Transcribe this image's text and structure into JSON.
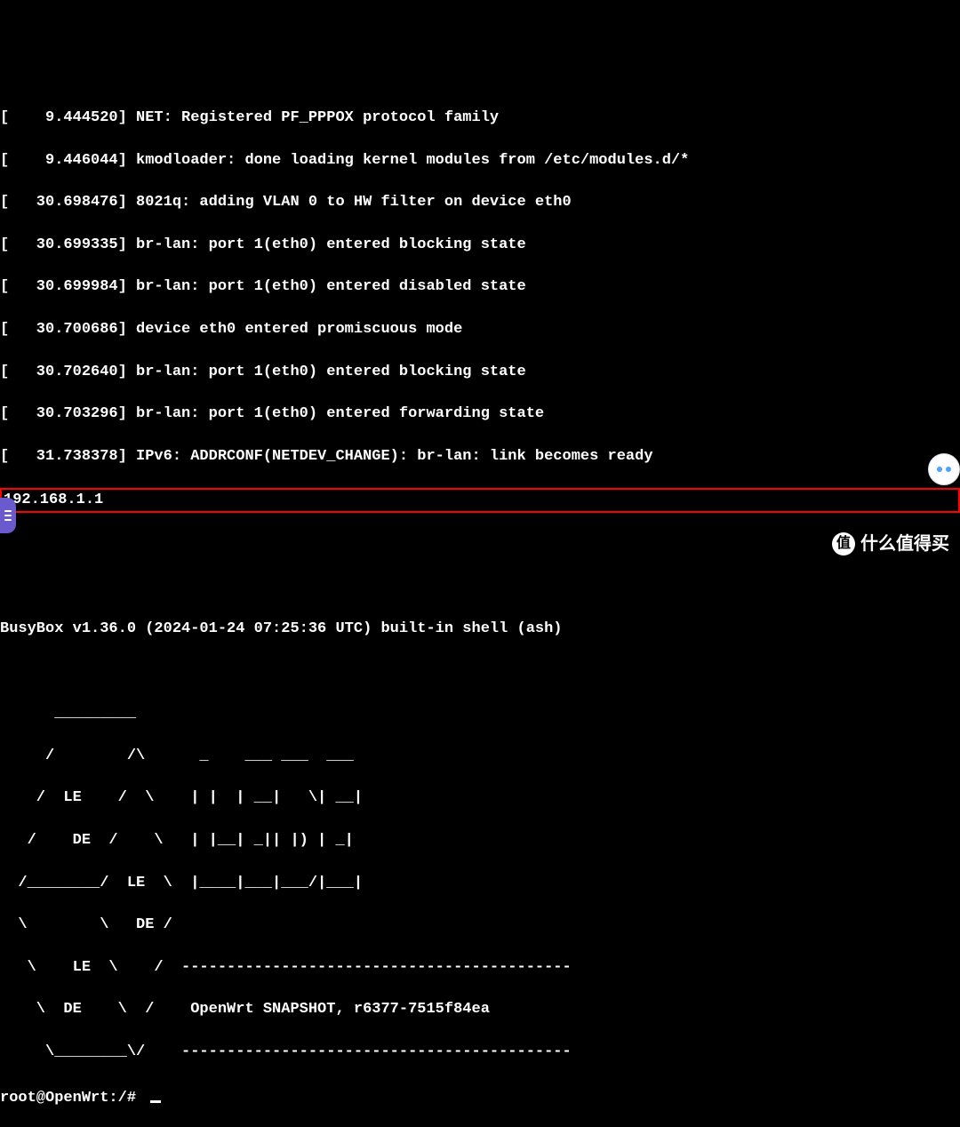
{
  "lines": {
    "l0": "[    9.444520] NET: Registered PF_PPPOX protocol family",
    "l1": "[    9.446044] kmodloader: done loading kernel modules from /etc/modules.d/*",
    "l2": "[   30.698476] 8021q: adding VLAN 0 to HW filter on device eth0",
    "l3": "[   30.699335] br-lan: port 1(eth0) entered blocking state",
    "l4": "[   30.699984] br-lan: port 1(eth0) entered disabled state",
    "l5": "[   30.700686] device eth0 entered promiscuous mode",
    "l6": "[   30.702640] br-lan: port 1(eth0) entered blocking state",
    "l7": "[   30.703296] br-lan: port 1(eth0) entered forwarding state",
    "l8": "[   31.738378] IPv6: ADDRCONF(NETDEV_CHANGE): br-lan: link becomes ready",
    "ip": "192.168.1.1",
    "blank1": " ",
    "blank2": " ",
    "bb": "BusyBox v1.36.0 (2024-01-24 07:25:36 UTC) built-in shell (ash)",
    "blank3": " ",
    "a0": "      _________",
    "a1": "     /        /\\      _    ___ ___  ___",
    "a2": "    /  LE    /  \\    | |  | __|   \\| __|",
    "a3": "   /    DE  /    \\   | |__| _|| |) | _|",
    "a4": "  /________/  LE  \\  |____|___|___/|___|",
    "a5": "  \\        \\   DE /",
    "a6": "   \\    LE  \\    /  -------------------------------------------",
    "a7": "    \\  DE    \\  /    OpenWrt SNAPSHOT, r6377-7515f84ea",
    "a8": "     \\________\\/    -------------------------------------------",
    "prompt": "root@OpenWrt:/# "
  },
  "watermark": {
    "icon_char": "值",
    "text": "什么值得买"
  }
}
